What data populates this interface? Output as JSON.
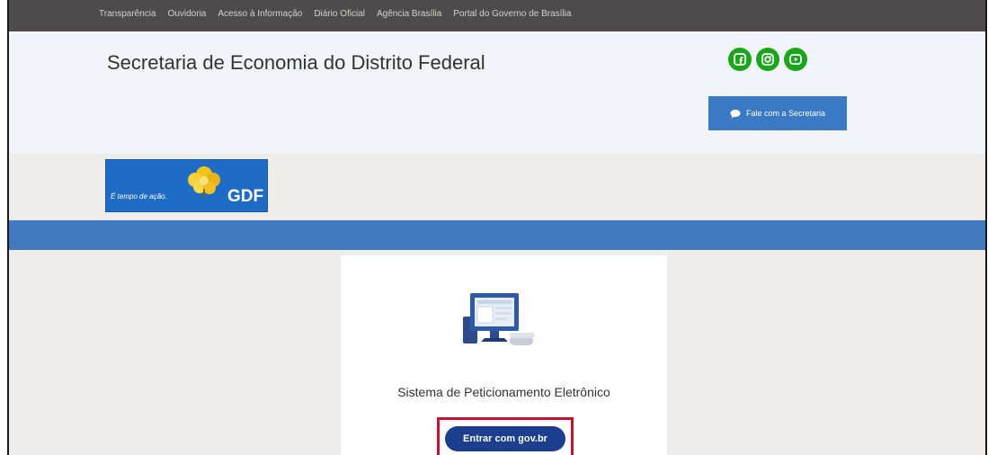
{
  "topbar": {
    "links": [
      "Transparência",
      "Ouvidoria",
      "Acesso à Informação",
      "Diário Oficial",
      "Agência Brasília",
      "Portal do Governo de Brasília"
    ]
  },
  "header": {
    "title": "Secretaria de Economia do Distrito Federal",
    "social_icons": [
      "facebook-icon",
      "instagram-icon",
      "youtube-icon"
    ],
    "contact_button": "Fale com a Secretaria"
  },
  "logo": {
    "slogan": "É tempo de ação.",
    "brand": "GDF"
  },
  "card": {
    "system_name": "Sistema de Peticionamento Eletrônico",
    "login_button": "Entrar com gov.br"
  },
  "colors": {
    "topbar": "#4d4b4b",
    "social_green": "#1aa51a",
    "contact_blue": "#3a7ac5",
    "blue_bar": "#4379bf",
    "govbr_button": "#1c3e8f",
    "highlight_red": "#c8102e"
  }
}
